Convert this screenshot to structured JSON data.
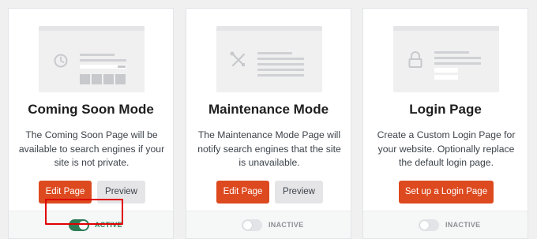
{
  "cards": [
    {
      "title": "Coming Soon Mode",
      "description": "The Coming Soon Page will be available to search engines if your site is not private.",
      "primary_button": "Edit Page",
      "secondary_button": "Preview",
      "status": "ACTIVE",
      "active": true,
      "illustration_icon": "clock-icon"
    },
    {
      "title": "Maintenance Mode",
      "description": "The Maintenance Mode Page will notify search engines that the site is unavailable.",
      "primary_button": "Edit Page",
      "secondary_button": "Preview",
      "status": "INACTIVE",
      "active": false,
      "illustration_icon": "tools-icon"
    },
    {
      "title": "Login Page",
      "description": "Create a Custom Login Page for your website. Optionally replace the default login page.",
      "primary_button": "Set up a Login Page",
      "status": "INACTIVE",
      "active": false,
      "illustration_icon": "lock-icon"
    }
  ],
  "colors": {
    "primary_button": "#dd4a1f",
    "active": "#2e7d56",
    "highlight_box": "#e00000"
  }
}
